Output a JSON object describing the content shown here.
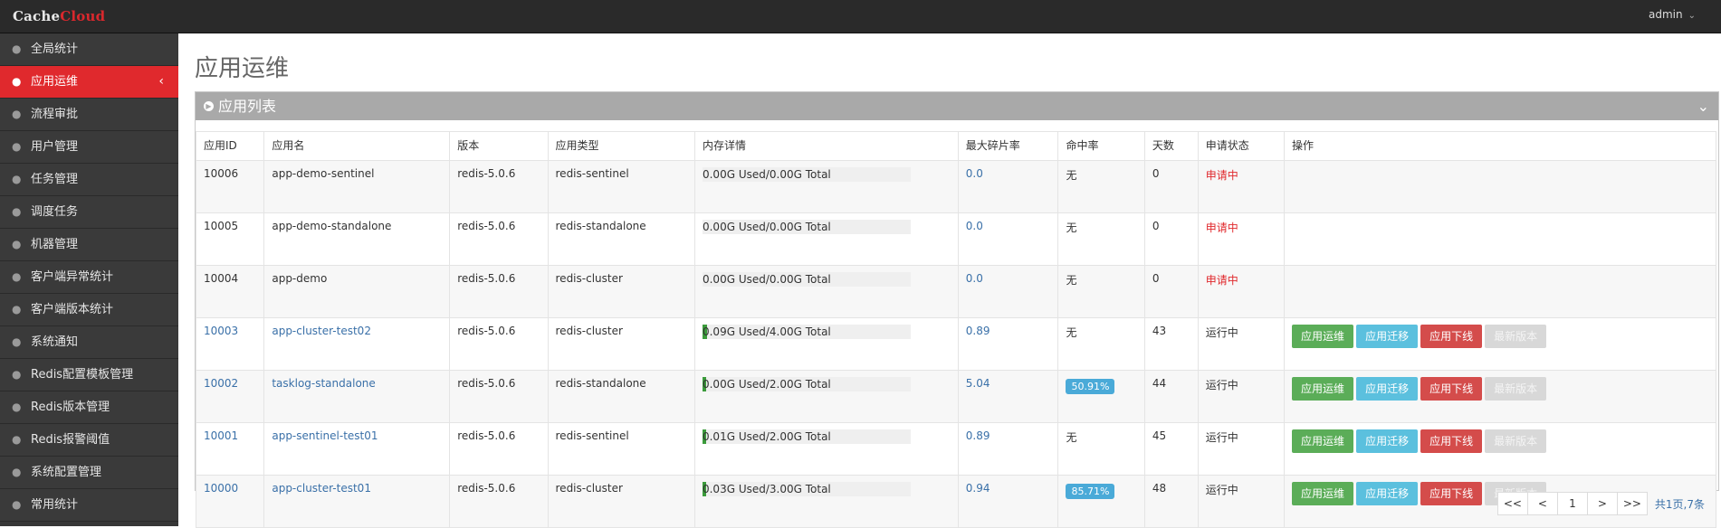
{
  "app": {
    "logo_part1": "Cache",
    "logo_part2": "Cloud",
    "user": "admin"
  },
  "colors": {
    "accent_red": "#e0292d",
    "link_blue": "#3a70a8",
    "green": "#5bad58",
    "info": "#5bc0de",
    "danger": "#d44c4b"
  },
  "sidebar": {
    "items": [
      {
        "label": "全局统计",
        "icon": "map-pin-icon"
      },
      {
        "label": "应用运维",
        "icon": "map-pin-icon",
        "active": true
      },
      {
        "label": "流程审批",
        "icon": "map-pin-icon"
      },
      {
        "label": "用户管理",
        "icon": "map-pin-icon"
      },
      {
        "label": "任务管理",
        "icon": "map-pin-icon"
      },
      {
        "label": "调度任务",
        "icon": "map-pin-icon"
      },
      {
        "label": "机器管理",
        "icon": "map-pin-icon"
      },
      {
        "label": "客户端异常统计",
        "icon": "map-pin-icon"
      },
      {
        "label": "客户端版本统计",
        "icon": "map-pin-icon"
      },
      {
        "label": "系统通知",
        "icon": "map-pin-icon"
      },
      {
        "label": "Redis配置模板管理",
        "icon": "map-pin-icon"
      },
      {
        "label": "Redis版本管理",
        "icon": "map-pin-icon"
      },
      {
        "label": "Redis报警阈值",
        "icon": "map-pin-icon"
      },
      {
        "label": "系统配置管理",
        "icon": "map-pin-icon"
      },
      {
        "label": "常用统计",
        "icon": "map-pin-icon"
      }
    ]
  },
  "main": {
    "title": "应用运维",
    "panel_title": "应用列表",
    "columns": [
      "应用ID",
      "应用名",
      "版本",
      "应用类型",
      "内存详情",
      "最大碎片率",
      "命中率",
      "天数",
      "申请状态",
      "操作"
    ],
    "rows": [
      {
        "id": "10006",
        "name": "app-demo-sentinel",
        "version": "redis-5.0.6",
        "type": "redis-sentinel",
        "mem_text": "0.00G  Used/0.00G  Total",
        "mem_fraction": 0,
        "frag": "0.0",
        "hit": "无",
        "hit_badge": false,
        "days": "0",
        "status": "申请中",
        "status_kind": "pending",
        "linked": false,
        "actions": false
      },
      {
        "id": "10005",
        "name": "app-demo-standalone",
        "version": "redis-5.0.6",
        "type": "redis-standalone",
        "mem_text": "0.00G  Used/0.00G  Total",
        "mem_fraction": 0,
        "frag": "0.0",
        "hit": "无",
        "hit_badge": false,
        "days": "0",
        "status": "申请中",
        "status_kind": "pending",
        "linked": false,
        "actions": false
      },
      {
        "id": "10004",
        "name": "app-demo",
        "version": "redis-5.0.6",
        "type": "redis-cluster",
        "mem_text": "0.00G  Used/0.00G  Total",
        "mem_fraction": 0,
        "frag": "0.0",
        "hit": "无",
        "hit_badge": false,
        "days": "0",
        "status": "申请中",
        "status_kind": "pending",
        "linked": false,
        "actions": false
      },
      {
        "id": "10003",
        "name": "app-cluster-test02",
        "version": "redis-5.0.6",
        "type": "redis-cluster",
        "mem_text": "0.09G  Used/4.00G  Total",
        "mem_fraction": 0.0225,
        "frag": "0.89",
        "hit": "无",
        "hit_badge": false,
        "days": "43",
        "status": "运行中",
        "status_kind": "running",
        "linked": true,
        "actions": true
      },
      {
        "id": "10002",
        "name": "tasklog-standalone",
        "version": "redis-5.0.6",
        "type": "redis-standalone",
        "mem_text": "0.00G  Used/2.00G  Total",
        "mem_fraction": 0.004,
        "frag": "5.04",
        "hit": "50.91%",
        "hit_badge": true,
        "days": "44",
        "status": "运行中",
        "status_kind": "running",
        "linked": true,
        "actions": true
      },
      {
        "id": "10001",
        "name": "app-sentinel-test01",
        "version": "redis-5.0.6",
        "type": "redis-sentinel",
        "mem_text": "0.01G  Used/2.00G  Total",
        "mem_fraction": 0.005,
        "frag": "0.89",
        "hit": "无",
        "hit_badge": false,
        "days": "45",
        "status": "运行中",
        "status_kind": "running",
        "linked": true,
        "actions": true
      },
      {
        "id": "10000",
        "name": "app-cluster-test01",
        "version": "redis-5.0.6",
        "type": "redis-cluster",
        "mem_text": "0.03G  Used/3.00G  Total",
        "mem_fraction": 0.01,
        "frag": "0.94",
        "hit": "85.71%",
        "hit_badge": true,
        "days": "48",
        "status": "运行中",
        "status_kind": "running",
        "linked": true,
        "actions": true
      }
    ],
    "action_labels": {
      "ops": "应用运维",
      "migrate": "应用迁移",
      "offline": "应用下线",
      "latest": "最新版本"
    }
  },
  "pager": {
    "first": "<<",
    "prev": "<",
    "page": "1",
    "next": ">",
    "last": ">>",
    "total": "共1页,7条"
  }
}
